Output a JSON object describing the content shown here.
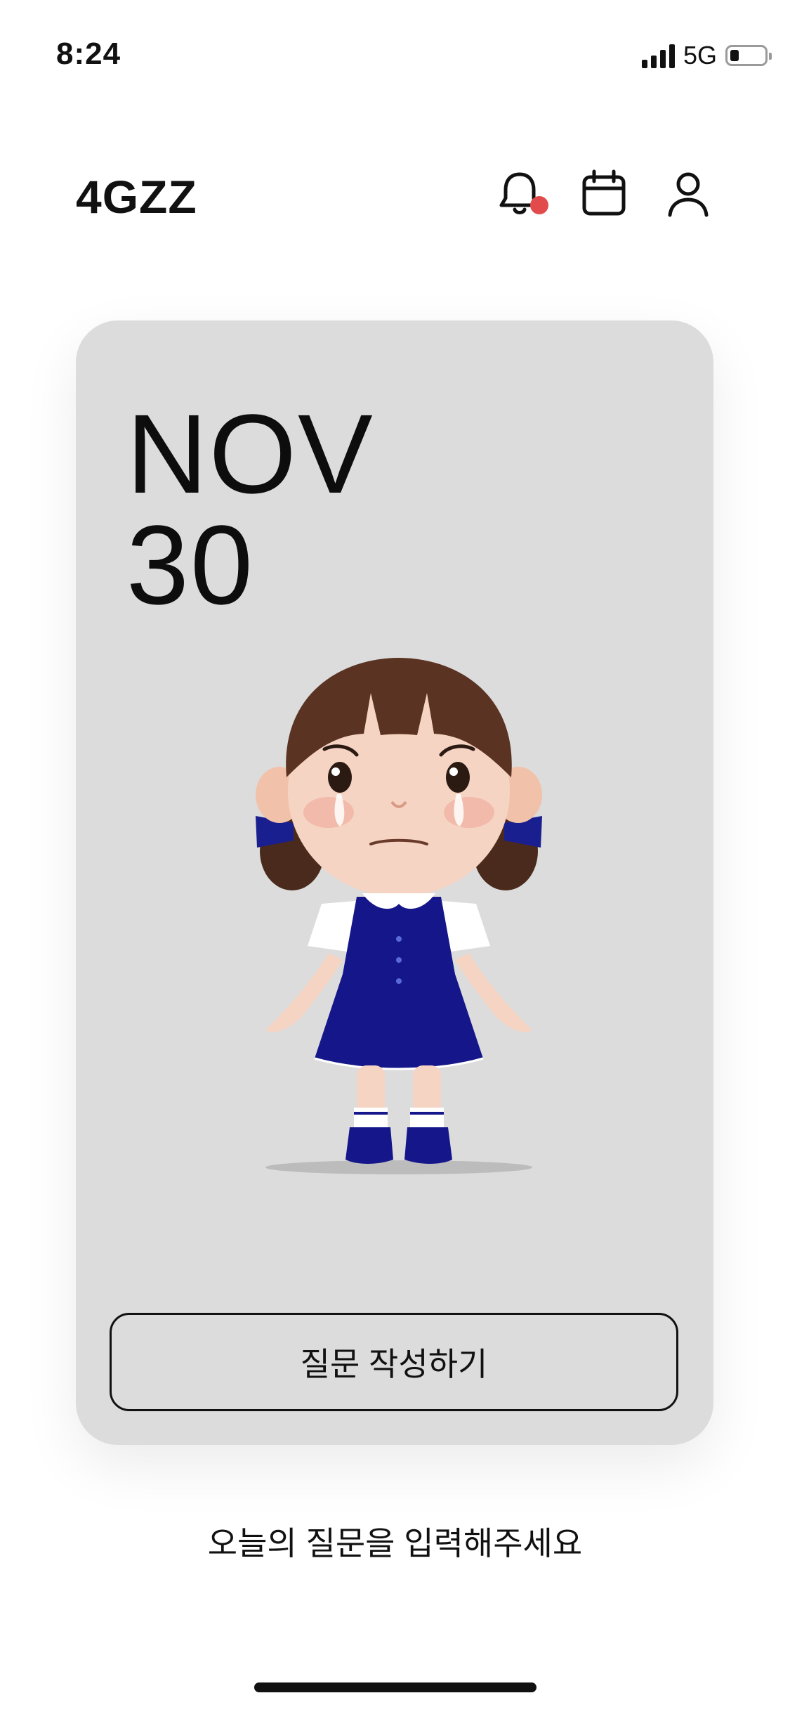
{
  "status_bar": {
    "time": "8:24",
    "network": "5G",
    "battery_level": 0.25
  },
  "header": {
    "brand": "4GZZ",
    "icons": [
      "bell-icon",
      "calendar-icon",
      "user-icon"
    ],
    "notification_dot_color": "#e14b4b"
  },
  "card": {
    "month": "NOV",
    "day": "30",
    "background": "#dcdcdc",
    "illustration": "crying-girl-character",
    "button_label": "질문 작성하기"
  },
  "footer": {
    "prompt": "오늘의 질문을 입력해주세요"
  }
}
